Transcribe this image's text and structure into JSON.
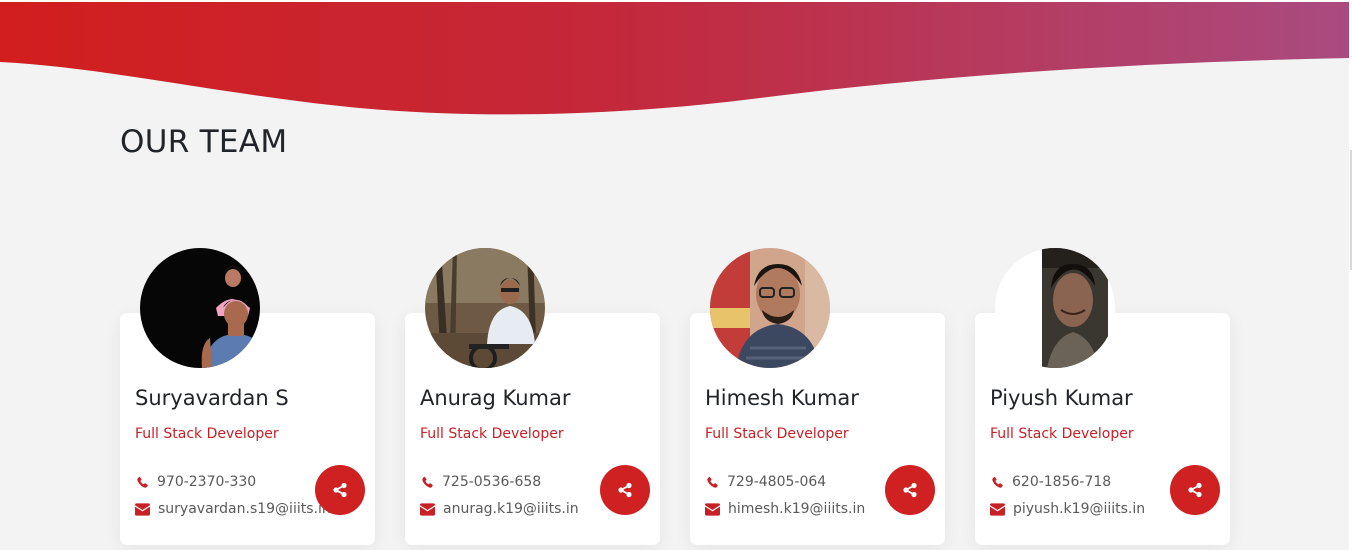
{
  "header": {
    "title": "OUR TEAM"
  },
  "colors": {
    "accent": "#cf2121",
    "wave_start": "#d21e1e",
    "wave_end": "#a94b80",
    "page_background": "#f3f3f3",
    "card_background": "#ffffff",
    "role_text": "#c72026"
  },
  "team": [
    {
      "name": "Suryavardan S",
      "role": "Full Stack Developer",
      "phone": "970-2370-330",
      "email": "suryavardan.s19@iiits.in",
      "phone_icon": "phone-icon",
      "email_icon": "envelope-icon",
      "share_icon": "share-icon"
    },
    {
      "name": "Anurag Kumar",
      "role": "Full Stack Developer",
      "phone": "725-0536-658",
      "email": "anurag.k19@iiits.in",
      "phone_icon": "phone-icon",
      "email_icon": "envelope-icon",
      "share_icon": "share-icon"
    },
    {
      "name": "Himesh Kumar",
      "role": "Full Stack Developer",
      "phone": "729-4805-064",
      "email": "himesh.k19@iiits.in",
      "phone_icon": "phone-icon",
      "email_icon": "envelope-icon",
      "share_icon": "share-icon"
    },
    {
      "name": "Piyush Kumar",
      "role": "Full Stack Developer",
      "phone": "620-1856-718",
      "email": "piyush.k19@iiits.in",
      "phone_icon": "phone-icon",
      "email_icon": "envelope-icon",
      "share_icon": "share-icon"
    }
  ]
}
